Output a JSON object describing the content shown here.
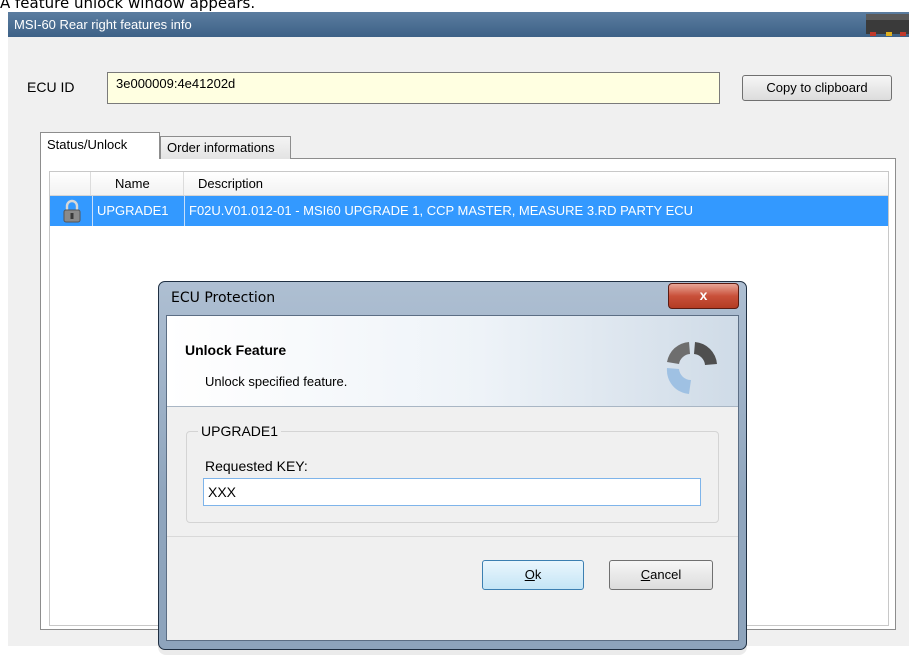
{
  "caption": "A feature unlock window appears.",
  "main_window": {
    "title": "MSI-60 Rear right features info",
    "ecu_id_label": "ECU ID",
    "ecu_id_value": "3e000009:4e41202d",
    "copy_button": "Copy to clipboard",
    "tabs": [
      {
        "label": "Status/Unlock",
        "selected": true
      },
      {
        "label": "Order informations",
        "selected": false
      }
    ],
    "table": {
      "columns": [
        "",
        "Name",
        "Description"
      ],
      "rows": [
        {
          "icon": "padlock-icon",
          "name": "UPGRADE1",
          "description": "F02U.V01.012-01 - MSI60 UPGRADE 1, CCP MASTER, MEASURE 3.RD PARTY ECU",
          "selected": true
        }
      ]
    }
  },
  "dialog": {
    "title": "ECU Protection",
    "close_glyph": "x",
    "banner_title": "Unlock Feature",
    "banner_subtitle": "Unlock specified feature.",
    "group_title": "UPGRADE1",
    "key_label": "Requested KEY:",
    "key_value": "XXX",
    "ok_mnemonic": "O",
    "ok_rest": "k",
    "cancel_mnemonic": "C",
    "cancel_rest": "ancel"
  },
  "colors": {
    "selection": "#3399ff",
    "ecu_field_bg": "#ffffe1",
    "title_bar": "#4a6d93"
  }
}
